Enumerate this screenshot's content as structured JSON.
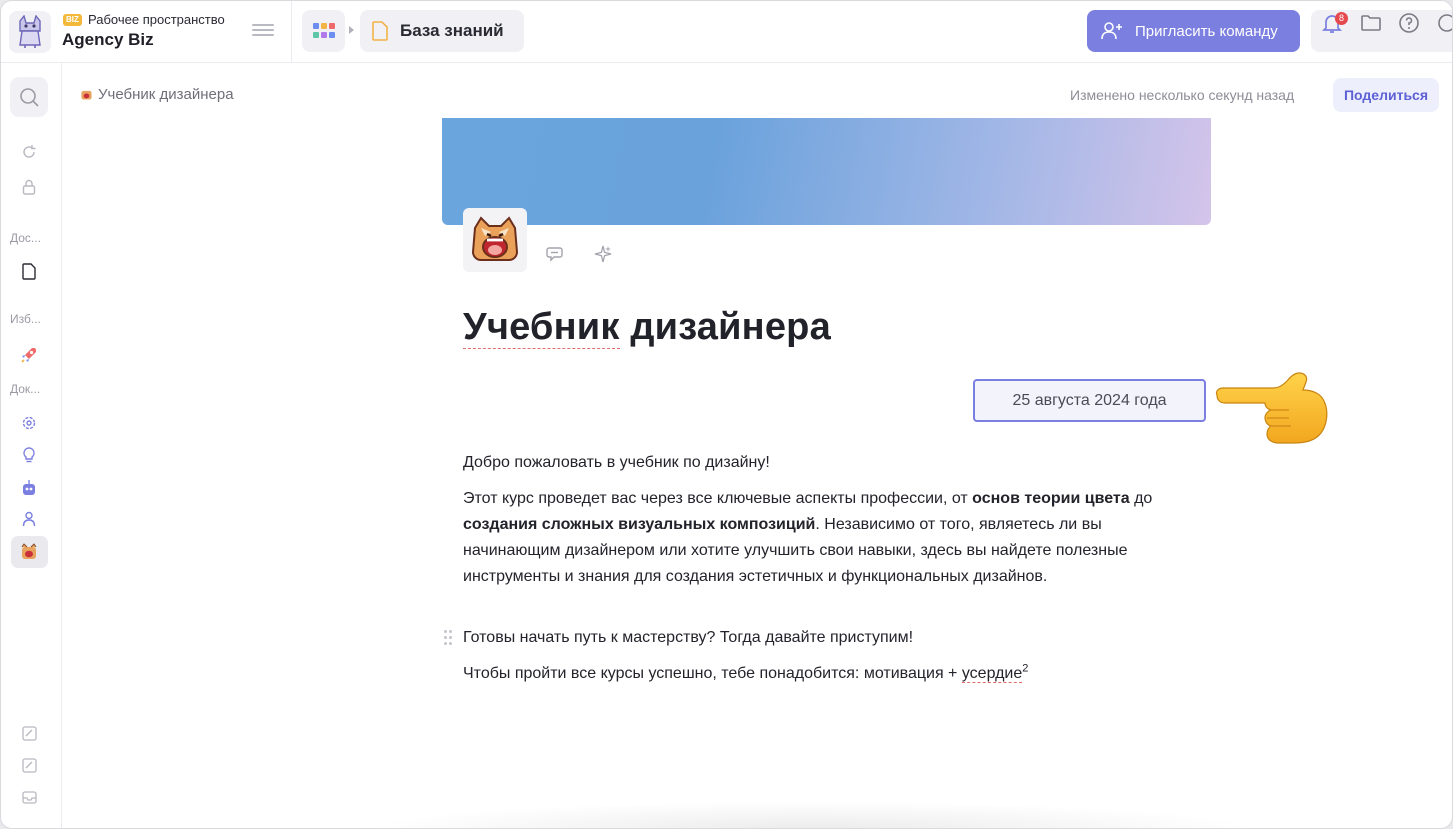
{
  "workspace": {
    "badge": "BIZ",
    "label": "Рабочее пространство",
    "name": "Agency Biz"
  },
  "topbar": {
    "current_tab": "База знаний",
    "invite_label": "Пригласить команду",
    "notifications_count": "8"
  },
  "sidebar": {
    "section_docs_short": "Дос...",
    "section_fav_short": "Изб...",
    "section_docs2_short": "Док..."
  },
  "header": {
    "breadcrumb": "Учебник дизайнера",
    "changed": "Изменено несколько секунд назад",
    "share_label": "Поделиться"
  },
  "doc": {
    "title_word1": "Учебник",
    "title_word2": "дизайнера",
    "date": "25 августа 2024 года",
    "p1": "Добро пожаловать в учебник по дизайну!",
    "p2_a": "Этот курс проведет вас через все ключевые аспекты профессии, от ",
    "p2_b": "основ теории цвета",
    "p2_c": " до ",
    "p2_d": "создания сложных визуальных композиций",
    "p2_e": ". Независимо от того, являетесь ли вы начинающим дизайнером или хотите улучшить свои навыки, здесь вы найдете полезные инструменты и знания для создания эстетичных и функциональных дизайнов.",
    "p3": "Готовы начать путь к мастерству? Тогда давайте приступим!",
    "p4_a": "Чтобы пройти все курсы успешно, тебе понадобится: мотивация + ",
    "p4_b": "усердие",
    "p4_sup": "2"
  },
  "colors": {
    "accent": "#7b7fe0",
    "share_bg": "#eeeffc",
    "share_text": "#5d61d6",
    "badge_red": "#e5484d",
    "biz_badge": "#f3b93a"
  },
  "icons": {
    "apps": "apps-grid-icon",
    "doc": "document-icon",
    "invite": "add-user-icon",
    "bell": "bell-icon",
    "folder": "folder-icon",
    "help": "help-icon",
    "search": "search-icon",
    "pointer": "pointing-hand-emoji"
  }
}
